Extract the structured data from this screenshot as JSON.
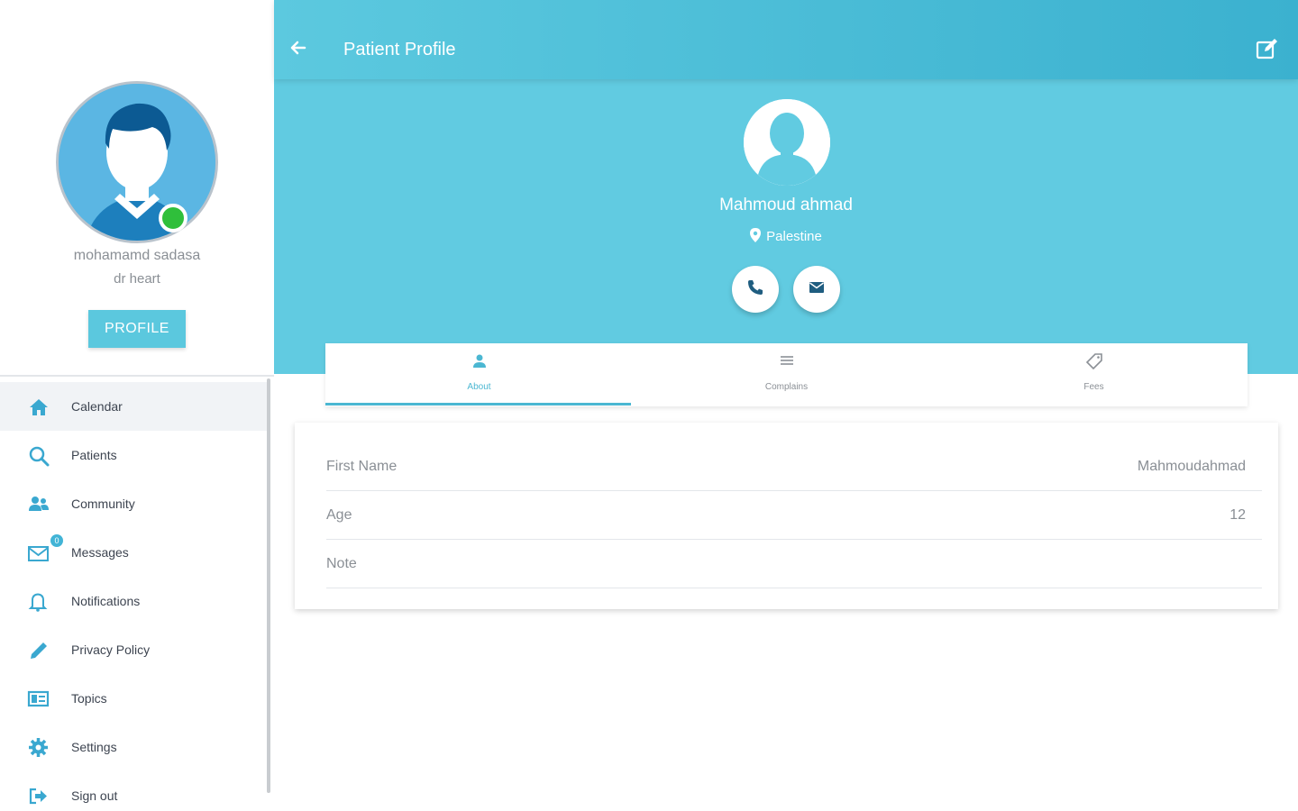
{
  "sidebar": {
    "doctor_name": "mohamamd sadasa",
    "doctor_specialty": "dr heart",
    "profile_button": "PROFILE",
    "menu": [
      {
        "label": "Calendar",
        "icon": "home-icon"
      },
      {
        "label": "Patients",
        "icon": "search-icon"
      },
      {
        "label": "Community",
        "icon": "people-icon"
      },
      {
        "label": "Messages",
        "icon": "mail-icon",
        "badge": "0"
      },
      {
        "label": "Notifications",
        "icon": "bell-icon"
      },
      {
        "label": "Privacy Policy",
        "icon": "pencil-icon"
      },
      {
        "label": "Topics",
        "icon": "topics-icon"
      },
      {
        "label": "Settings",
        "icon": "gear-icon"
      },
      {
        "label": "Sign out",
        "icon": "signout-icon"
      }
    ]
  },
  "header": {
    "title": "Patient Profile"
  },
  "patient": {
    "name": "Mahmoud ahmad",
    "location": "Palestine"
  },
  "tabs": [
    {
      "label": "About",
      "icon": "person-icon",
      "active": true
    },
    {
      "label": "Complains",
      "icon": "list-icon",
      "active": false
    },
    {
      "label": "Fees",
      "icon": "tag-icon",
      "active": false
    }
  ],
  "details": [
    {
      "label": "First Name",
      "value": "Mahmoudahmad"
    },
    {
      "label": "Age",
      "value": "12"
    },
    {
      "label": "Note",
      "value": ""
    }
  ],
  "colors": {
    "primary": "#61cbe1",
    "appbar_end": "#3bb1cf",
    "accent": "#4bb7d2",
    "online": "#2fbf3b"
  }
}
